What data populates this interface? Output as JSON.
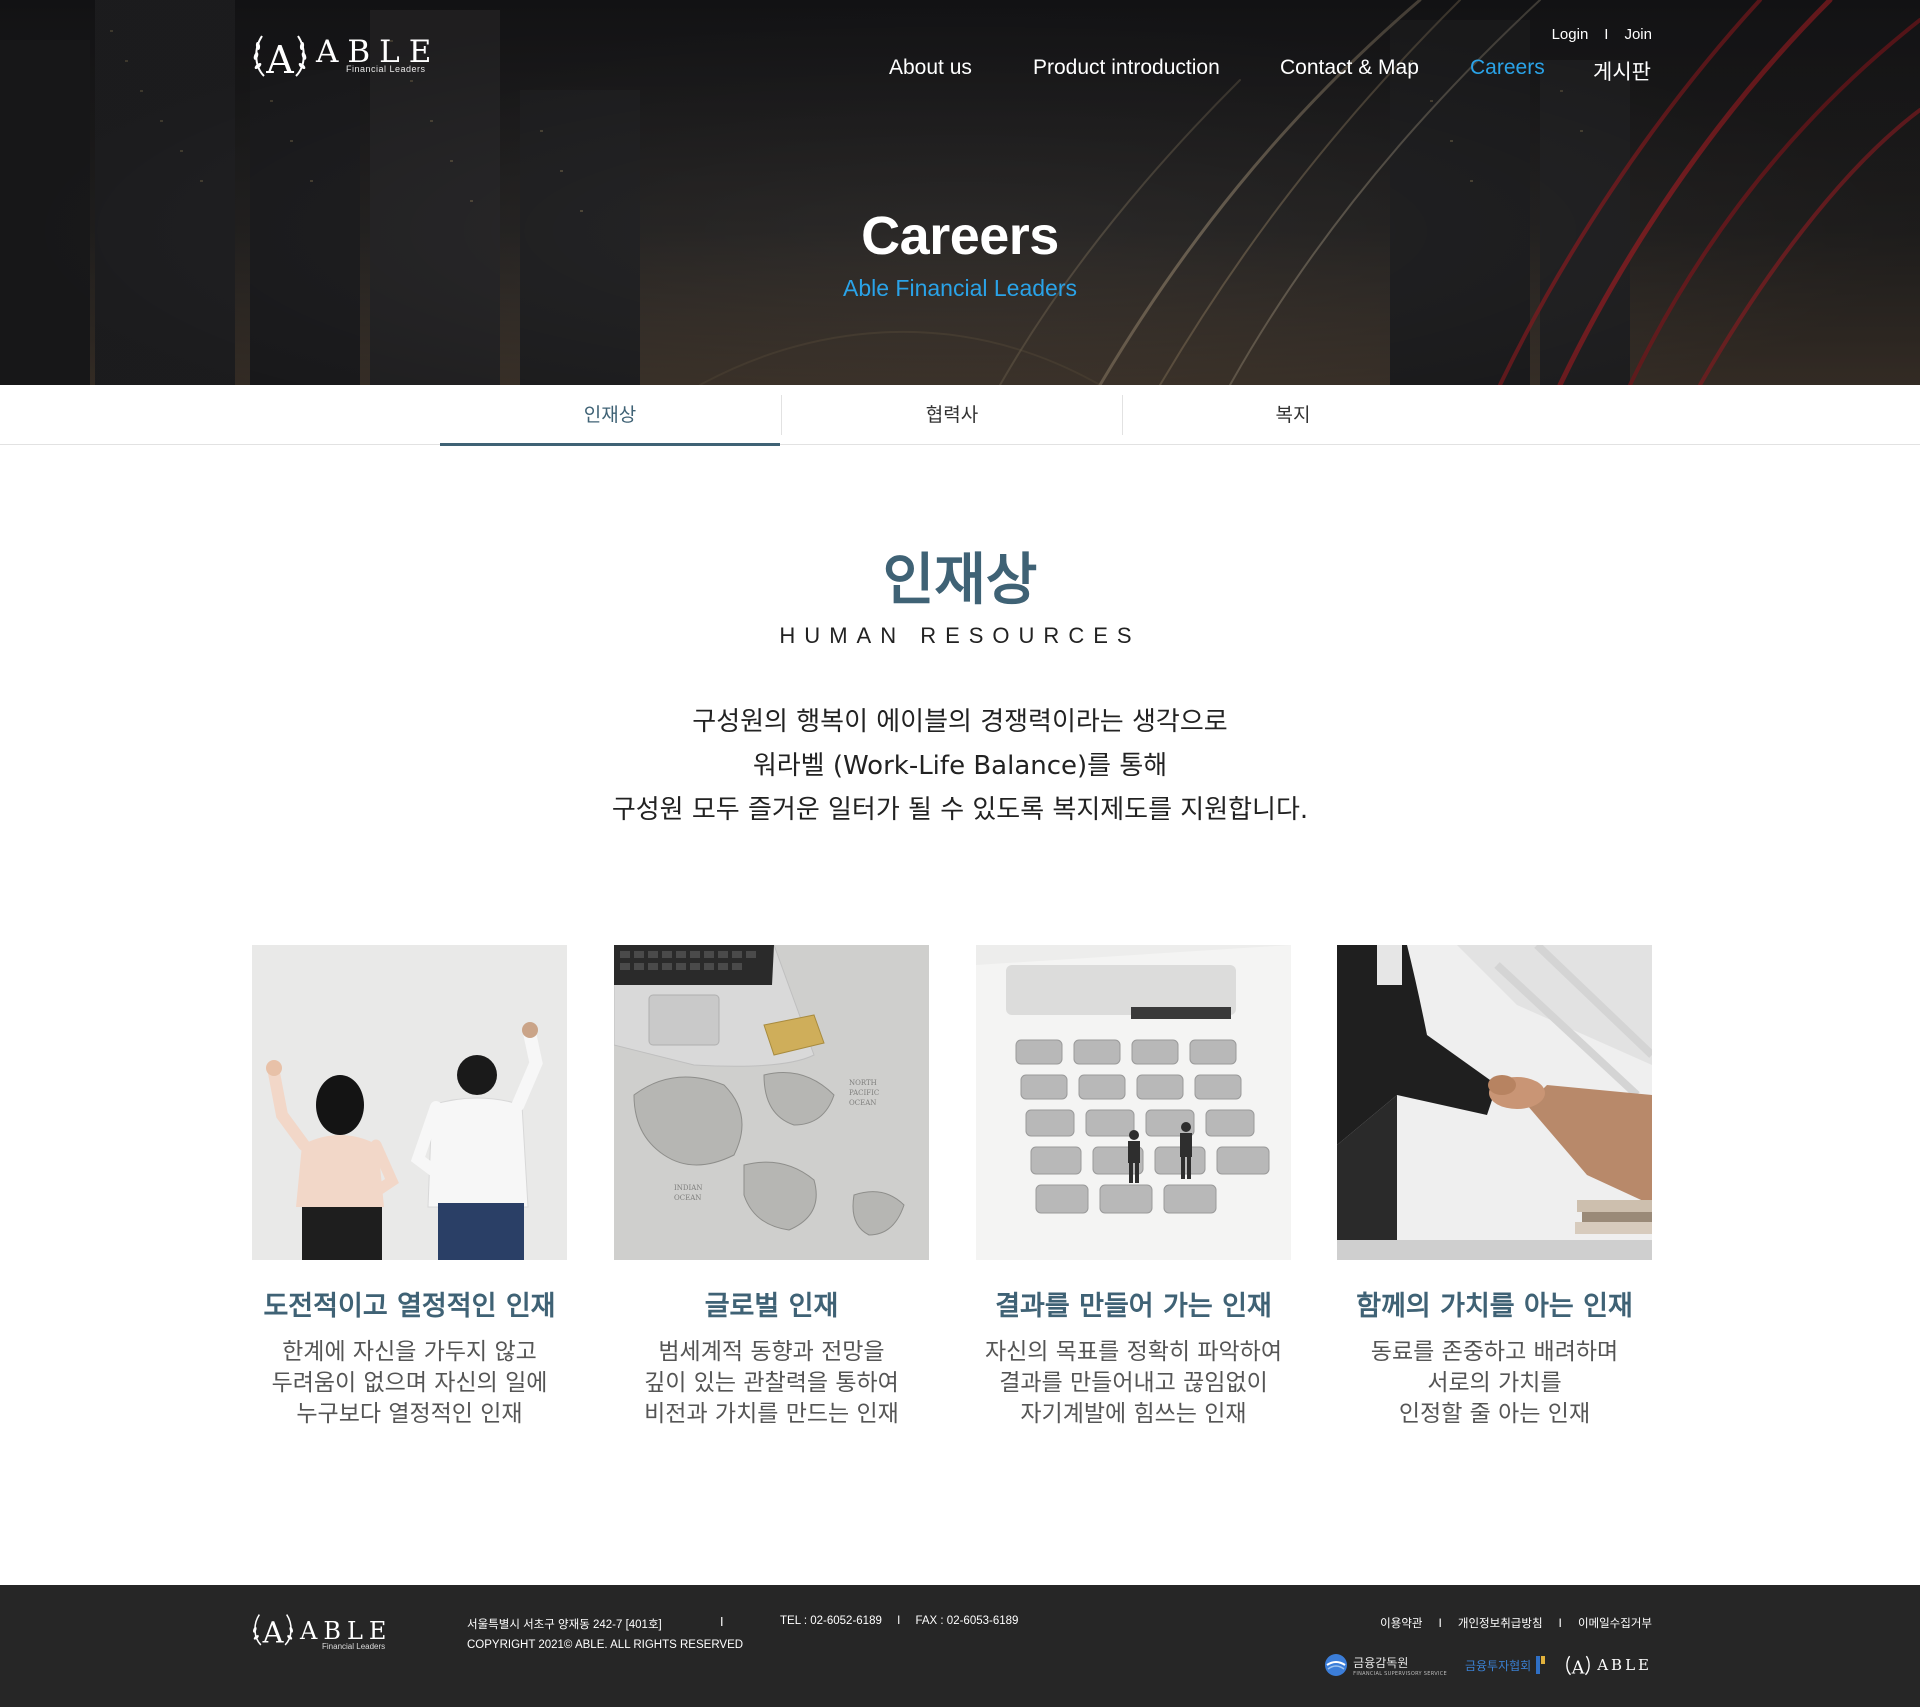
{
  "brand": {
    "name": "ABLE",
    "tagline": "Financial Leaders"
  },
  "util": {
    "login": "Login",
    "separator": "I",
    "join": "Join"
  },
  "nav": [
    {
      "label": "About us"
    },
    {
      "label": "Product introduction"
    },
    {
      "label": "Contact & Map"
    },
    {
      "label": "Careers",
      "active": true
    },
    {
      "label": "게시판"
    }
  ],
  "hero": {
    "title": "Careers",
    "subtitle": "Able Financial Leaders"
  },
  "tabs": [
    {
      "label": "인재상",
      "active": true
    },
    {
      "label": "협력사"
    },
    {
      "label": "복지"
    }
  ],
  "section": {
    "title": "인재상",
    "subtitle": "HUMAN RESOURCES",
    "desc": [
      "구성원의 행복이 에이블의 경쟁력이라는 생각으로",
      "워라벨 (Work-Life Balance)를 통해",
      "구성원 모두 즐거운 일터가 될 수 있도록 복지제도를 지원합니다."
    ]
  },
  "cards": [
    {
      "image": "people-raising-fists",
      "title": "도전적이고 열정적인 인재",
      "desc": [
        "한계에 자신을 가두지 않고",
        "두려움이 없으며 자신의 일에",
        "누구보다 열정적인 인재"
      ]
    },
    {
      "image": "laptop-on-world-map",
      "title": "글로벌 인재",
      "desc": [
        "범세계적 동향과 전망을",
        "깊이 있는 관찰력을 통하여",
        "비전과 가치를 만드는 인재"
      ]
    },
    {
      "image": "calculator-miniature-people",
      "title": "결과를 만들어 가는 인재",
      "desc": [
        "자신의 목표를 정확히 파악하여",
        "결과를 만들어내고 끊임없이",
        "자기계발에 힘쓰는 인재"
      ]
    },
    {
      "image": "handshake",
      "title": "함께의 가치를 아는 인재",
      "desc": [
        "동료를 존중하고 배려하며",
        "서로의 가치를",
        "인정할 줄 아는 인재"
      ]
    }
  ],
  "footer": {
    "address": "서울특별시 서초구 양재동 242-7 [401호]",
    "copyright": "COPYRIGHT 2021© ABLE. ALL RIGHTS RESERVED",
    "pipe": "I",
    "tel": "TEL : 02-6052-6189",
    "fax": "FAX : 02-6053-6189",
    "links": [
      "이용약관",
      "개인정보취급방침",
      "이메일수집거부"
    ],
    "badges": [
      {
        "label": "금융감독원",
        "sublabel": "FINANCIAL SUPERVISORY SERVICE"
      },
      {
        "label": "금융투자협회"
      },
      {
        "label": "ABLE"
      }
    ]
  },
  "colors": {
    "accent": "#2aa3e8",
    "heading": "#3f6275",
    "footer_bg": "#262626"
  }
}
